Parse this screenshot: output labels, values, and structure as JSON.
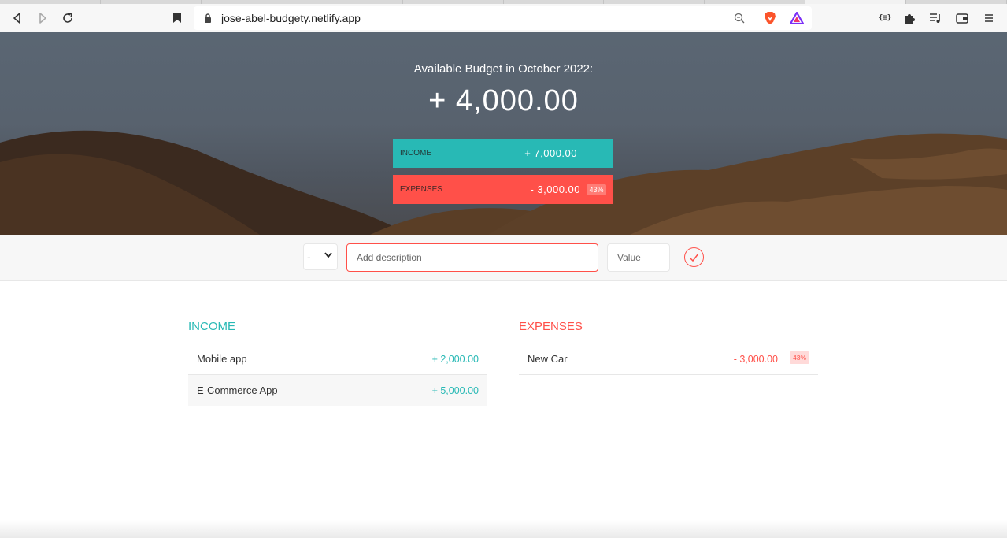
{
  "browser": {
    "url": "jose-abel-budgety.netlify.app"
  },
  "budget": {
    "title": "Available Budget in October 2022:",
    "value": "+ 4,000.00",
    "income_label": "Income",
    "income_value": "+ 7,000.00",
    "expenses_label": "Expenses",
    "expenses_value": "- 3,000.00",
    "expenses_percentage": "43%"
  },
  "add_form": {
    "type_value": "-",
    "description_placeholder": "Add description",
    "value_placeholder": "Value"
  },
  "income": {
    "title": "Income",
    "items": [
      {
        "description": "Mobile app",
        "value": "+ 2,000.00"
      },
      {
        "description": "E-Commerce App",
        "value": "+ 5,000.00"
      }
    ]
  },
  "expenses": {
    "title": "Expenses",
    "items": [
      {
        "description": "New Car",
        "value": "- 3,000.00",
        "percentage": "43%"
      }
    ]
  },
  "colors": {
    "income": "#28b9b5",
    "expenses": "#ff5049"
  }
}
